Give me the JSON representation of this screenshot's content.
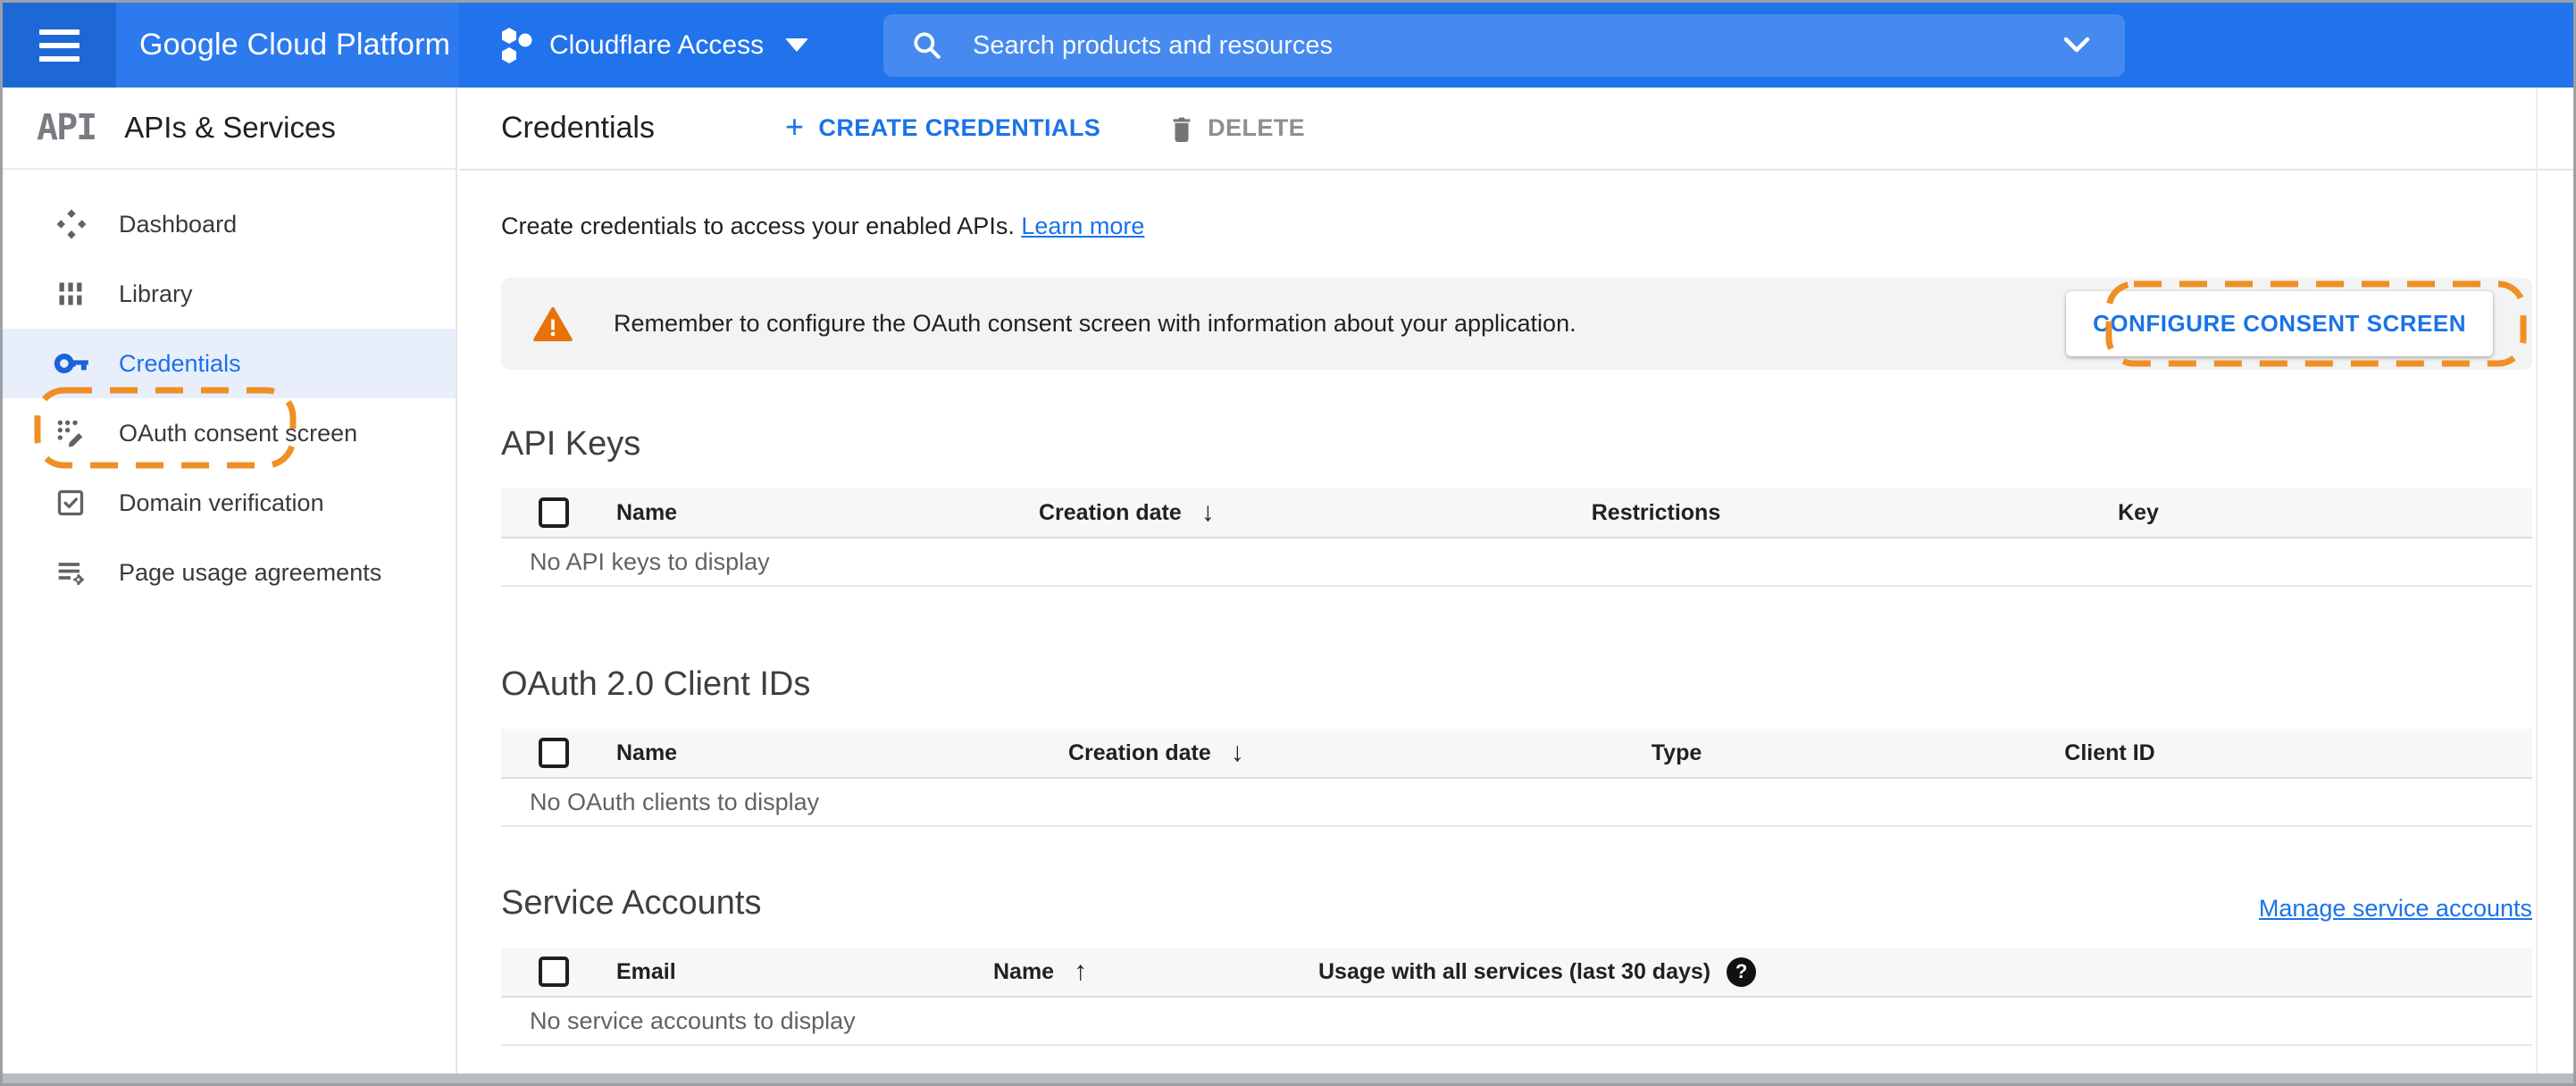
{
  "header": {
    "logo": "Google Cloud Platform",
    "project_selector": "Cloudflare Access",
    "search_placeholder": "Search products and resources"
  },
  "sidebar": {
    "logo": "API",
    "title": "APIs & Services",
    "items": [
      {
        "label": "Dashboard",
        "selected": false
      },
      {
        "label": "Library",
        "selected": false
      },
      {
        "label": "Credentials",
        "selected": true
      },
      {
        "label": "OAuth consent screen",
        "selected": false
      },
      {
        "label": "Domain verification",
        "selected": false
      },
      {
        "label": "Page usage agreements",
        "selected": false
      }
    ]
  },
  "page": {
    "title": "Credentials",
    "create_button": "CREATE CREDENTIALS",
    "delete_button": "DELETE",
    "description": "Create credentials to access your enabled APIs.",
    "learn_more": "Learn more",
    "banner": {
      "text": "Remember to configure the OAuth consent screen with information about your application.",
      "button": "CONFIGURE CONSENT SCREEN"
    },
    "sections": [
      {
        "title": "API Keys",
        "columns": [
          "Name",
          "Creation date",
          "Restrictions",
          "Key"
        ],
        "sorted_column": "Creation date",
        "sort_direction": "desc",
        "empty": "No API keys to display"
      },
      {
        "title": "OAuth 2.0 Client IDs",
        "columns": [
          "Name",
          "Creation date",
          "Type",
          "Client ID"
        ],
        "sorted_column": "Creation date",
        "sort_direction": "desc",
        "empty": "No OAuth clients to display"
      },
      {
        "title": "Service Accounts",
        "link": "Manage service accounts",
        "columns": [
          "Email",
          "Name",
          "Usage with all services (last 30 days)"
        ],
        "sorted_column": "Name",
        "sort_direction": "asc",
        "empty": "No service accounts to display"
      }
    ]
  },
  "icons": {
    "sort_desc_glyph": "↓",
    "sort_asc_glyph": "↑",
    "help_glyph": "?",
    "plus_glyph": "+"
  },
  "colors": {
    "header_blue": "#2173ec",
    "accent_blue": "#1a73e8",
    "warning_orange": "#e8710a",
    "annotation_orange": "#ef8f25",
    "selected_row": "#e9eefb",
    "banner_gray": "#f2f3f3"
  }
}
